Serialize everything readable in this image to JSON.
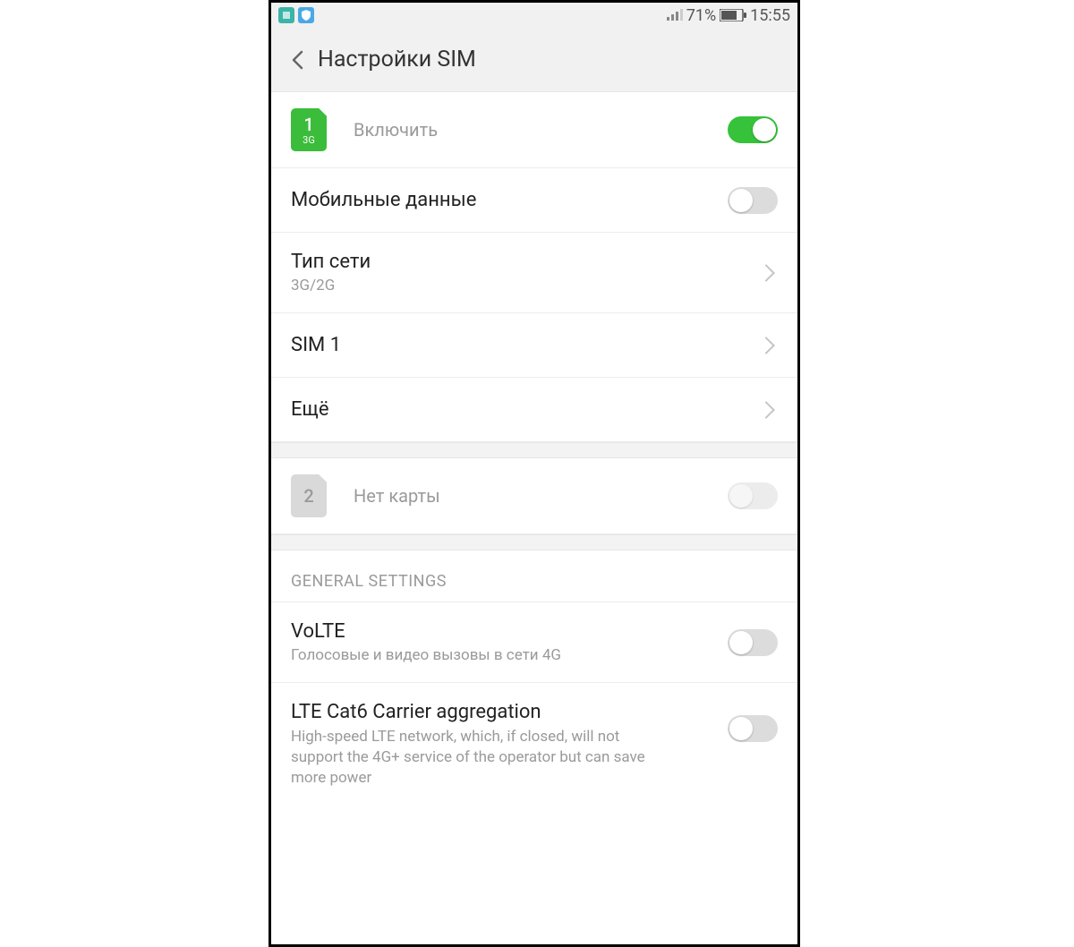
{
  "statusbar": {
    "battery_pct": "71%",
    "time": "15:55"
  },
  "header": {
    "title": "Настройки SIM"
  },
  "sim1": {
    "num": "1",
    "net": "3G",
    "enable_label": "Включить"
  },
  "rows": {
    "mobile_data": "Мобильные данные",
    "network_type_title": "Тип сети",
    "network_type_value": "3G/2G",
    "sim1_label": "SIM 1",
    "more_label": "Ещё"
  },
  "sim2": {
    "num": "2",
    "no_card": "Нет карты"
  },
  "general": {
    "section": "GENERAL SETTINGS",
    "volte_title": "VoLTE",
    "volte_sub": "Голосовые и видео вызовы в сети 4G",
    "cat6_title": "LTE Cat6 Carrier aggregation",
    "cat6_sub": "High-speed LTE network, which, if closed, will not support the 4G+ service of the operator but can save more power"
  }
}
